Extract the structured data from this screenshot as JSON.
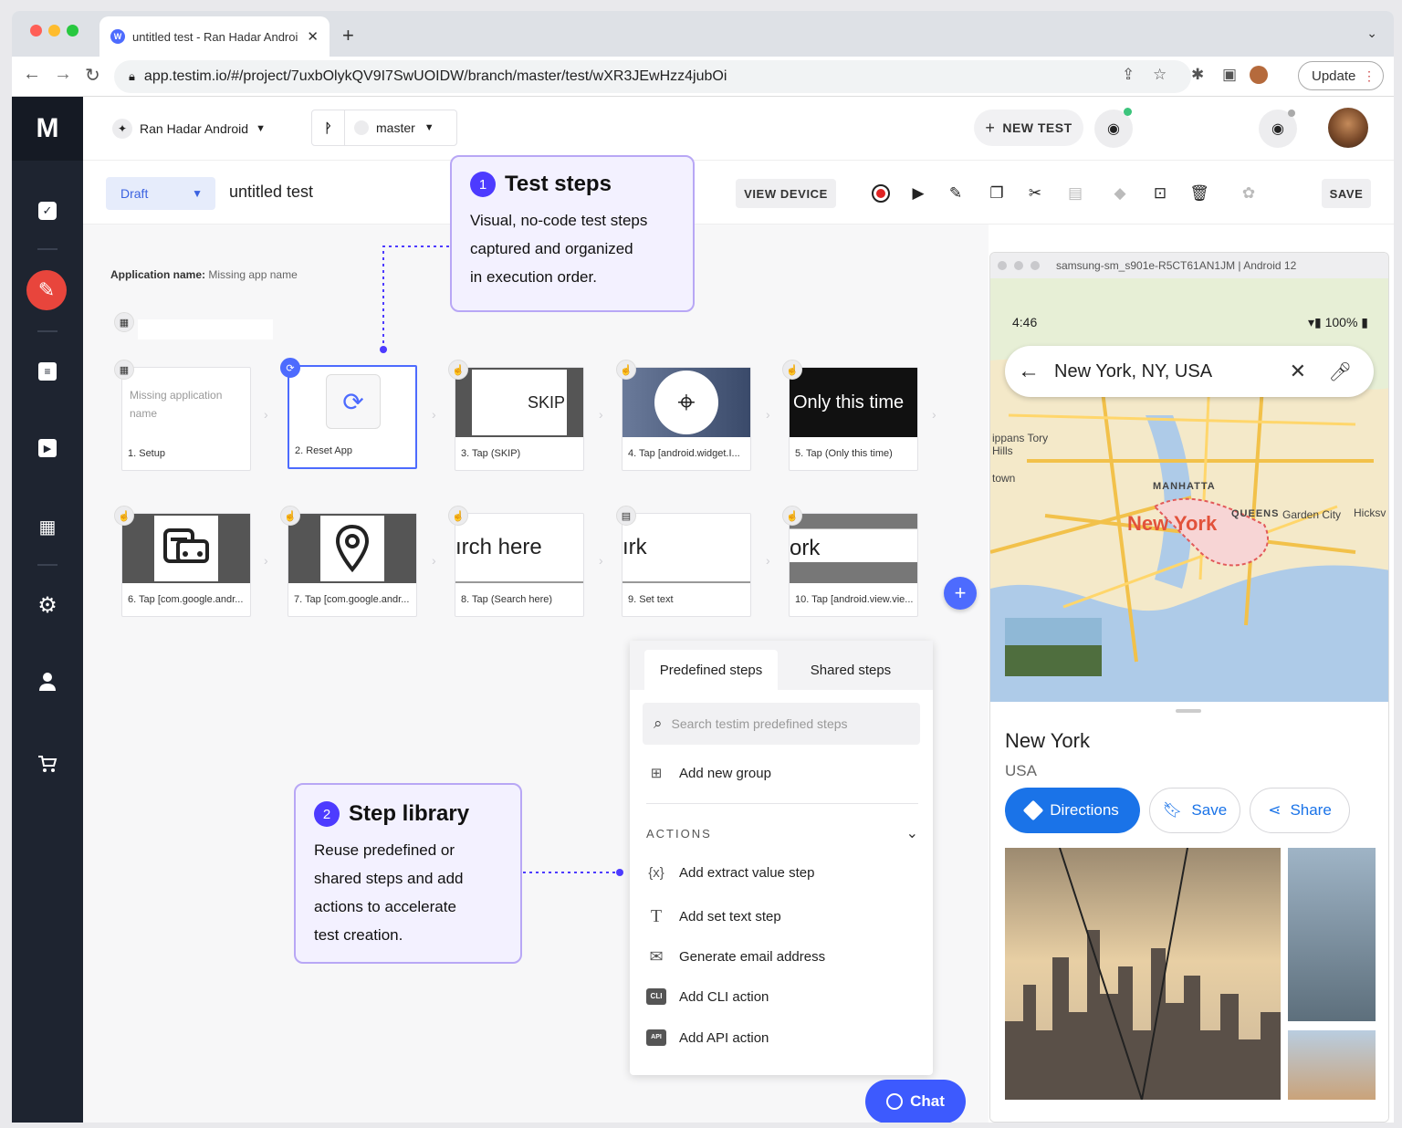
{
  "browser": {
    "tab_title": "untitled test - Ran Hadar Androi",
    "url": "app.testim.io/#/project/7uxbOlykQV9I7SwUOIDW/branch/master/test/wXR3JEwHzz4jubOi",
    "update_label": "Update"
  },
  "header": {
    "project": "Ran Hadar Android",
    "branch": "master",
    "new_test": "NEW TEST"
  },
  "toolbar": {
    "status": "Draft",
    "test_name": "untitled test",
    "view_device": "VIEW DEVICE",
    "save": "SAVE"
  },
  "canvas": {
    "app_name_label": "Application name:",
    "app_name_value": "Missing app name",
    "setup_thumb_text": "Missing application name",
    "steps": [
      {
        "label": "1. Setup"
      },
      {
        "label": "2. Reset App"
      },
      {
        "label": "3. Tap (SKIP)",
        "thumb": "SKIP"
      },
      {
        "label": "4. Tap [android.widget.I..."
      },
      {
        "label": "5. Tap (Only this time)",
        "thumb": "Only this time"
      },
      {
        "label": "6. Tap [com.google.andr..."
      },
      {
        "label": "7. Tap [com.google.andr..."
      },
      {
        "label": "8. Tap (Search here)",
        "thumb": "ırch here"
      },
      {
        "label": "9. Set text",
        "thumb": "ırk"
      },
      {
        "label": "10. Tap [android.view.vie...",
        "thumb": "ork"
      }
    ]
  },
  "callouts": {
    "test_steps": {
      "num": "1",
      "title": "Test steps",
      "lines": [
        "Visual, no-code test steps",
        "captured and organized",
        "in execution order."
      ]
    },
    "step_library": {
      "num": "2",
      "title": "Step library",
      "lines": [
        "Reuse predefined or",
        "shared steps and add",
        "actions to accelerate",
        "test creation."
      ]
    }
  },
  "library": {
    "tabs": [
      "Predefined steps",
      "Shared steps"
    ],
    "search_placeholder": "Search testim predefined steps",
    "add_group": "Add new group",
    "actions_header": "ACTIONS",
    "actions": [
      {
        "icon": "{x}",
        "label": "Add extract value step"
      },
      {
        "icon": "T",
        "label": "Add set text step"
      },
      {
        "icon": "✉",
        "label": "Generate email address"
      },
      {
        "icon": "CLI",
        "label": "Add CLI action"
      },
      {
        "icon": "API",
        "label": "Add API action"
      }
    ]
  },
  "chat_label": "Chat",
  "device": {
    "title": "samsung-sm_s901e-R5CT61AN1JM | Android 12",
    "time": "4:46",
    "battery": "100%",
    "search_text": "New York, NY, USA",
    "map_labels": [
      "ippans Tory Hills",
      "town",
      "MANHATTA",
      "New York",
      "QUEENS",
      "Garden City",
      "Hicksv"
    ],
    "place": "New York",
    "country": "USA",
    "buttons": [
      "Directions",
      "Save",
      "Share"
    ]
  },
  "colors": {
    "accent": "#4d6bfe",
    "sidebar": "#1e2430",
    "callout_border": "#b8a7f5",
    "maps_blue": "#1a73e8"
  }
}
